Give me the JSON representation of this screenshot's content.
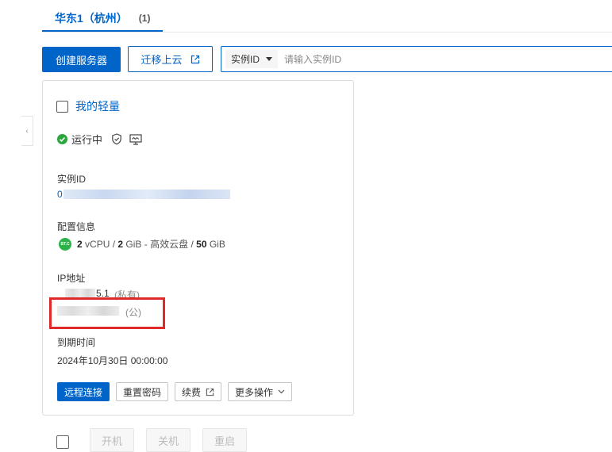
{
  "region_tab": {
    "label": "华东1（杭州）",
    "count": "(1)"
  },
  "toolbar": {
    "create_label": "创建服务器",
    "migrate_label": "迁移上云",
    "search_field": "实例ID",
    "search_placeholder": "请输入实例ID",
    "search_value": ""
  },
  "card": {
    "title": "我的轻量",
    "status": "运行中",
    "instance_id_label": "实例ID",
    "instance_id_value": "0",
    "config_label": "配置信息",
    "config": {
      "os_badge": "BT.C",
      "cpu": "2",
      "cpu_unit": "vCPU",
      "mem": "2",
      "mem_unit": "GiB",
      "disk_type": "高效云盘",
      "disk": "50",
      "disk_unit": "GiB"
    },
    "ip_label": "IP地址",
    "private_ip_partial": "5.1",
    "private_tag": "(私有)",
    "public_tag": "(公)",
    "expiry_label": "到期时间",
    "expiry_value": "2024年10月30日 00:00:00",
    "actions": {
      "remote": "远程连接",
      "reset_password": "重置密码",
      "renew": "续费",
      "more": "更多操作"
    }
  },
  "batch": {
    "start": "开机",
    "stop": "关机",
    "restart": "重启"
  },
  "colors": {
    "accent": "#0064c8",
    "status_green": "#2aa63c",
    "highlight_red": "#e02a2a"
  }
}
